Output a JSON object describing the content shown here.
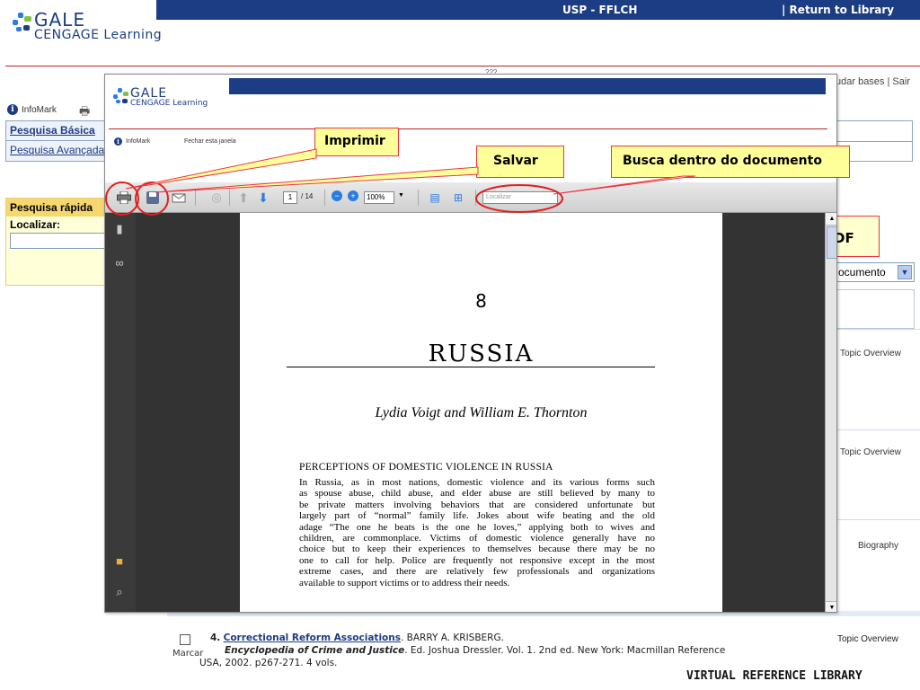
{
  "header": {
    "institution": "USP - FFLCH",
    "return_link": "| Return to Library",
    "top_right_links": "udar bases | Sair",
    "small_top_text": "???"
  },
  "logo": {
    "line1": "GALE",
    "line2": "CENGAGE Learning",
    "trademark": "·"
  },
  "nav": {
    "infomark": "InfoMark",
    "search_links": [
      "Pesquisa Básica",
      "Pesquisa Avançada"
    ]
  },
  "quick_search": {
    "title": "Pesquisa rápida",
    "label": "Localizar:"
  },
  "callouts": {
    "pdf": "DF",
    "imprimir": "Imprimir",
    "salvar": "Salvar",
    "busca": "Busca dentro do documento"
  },
  "results": {
    "sort_value": "ocumento",
    "types": [
      "Topic Overview",
      "Topic Overview",
      "Biography"
    ],
    "item4": {
      "number": "4.",
      "title": "Correctional Reform Associations",
      "author": ". BARRY A. KRISBERG.",
      "source": "Encyclopedia of Crime and Justice",
      "source_rest": ". Ed. Joshua Dressler. Vol. 1. 2nd ed. New York: Macmillan Reference",
      "line3": "USA, 2002. p267-271. 4 vols.",
      "mark_label": "Marcar",
      "type": "Topic Overview"
    },
    "footer_brand": "VIRTUAL REFERENCE LIBRARY"
  },
  "popup": {
    "infomark": "InfoMark",
    "close_window": "Fechar esta janela",
    "toolbar": {
      "current_page": "1",
      "total_pages": "/ 14",
      "zoom": "100%",
      "search_placeholder": "Localizar"
    },
    "document": {
      "chapter_number": "8",
      "chapter_title": "RUSSIA",
      "authors": "Lydia Voigt and William E. Thornton",
      "section_heading": "PERCEPTIONS OF DOMESTIC VIOLENCE IN RUSSIA",
      "body_lines": [
        "In Russia, as in most nations, domestic violence and its various forms such",
        "as spouse abuse, child abuse, and elder abuse are still believed by many to",
        "be private matters involving behaviors that are considered unfortunate but",
        "largely part of “normal” family life. Jokes about wife beating and the old",
        "adage “The one he beats is the one he loves,” applying both to wives and",
        "children, are commonplace. Victims of domestic violence generally have no",
        "choice but to keep their experiences to themselves because there may be no",
        "one to call for help. Police are frequently not responsive except in the most",
        "extreme cases, and there are relatively few professionals and organizations",
        "available to support victims or to address their needs."
      ]
    }
  },
  "colors": {
    "brand_blue": "#1c3d83",
    "callout_yellow": "#ffff9a",
    "callout_red": "#e34"
  }
}
